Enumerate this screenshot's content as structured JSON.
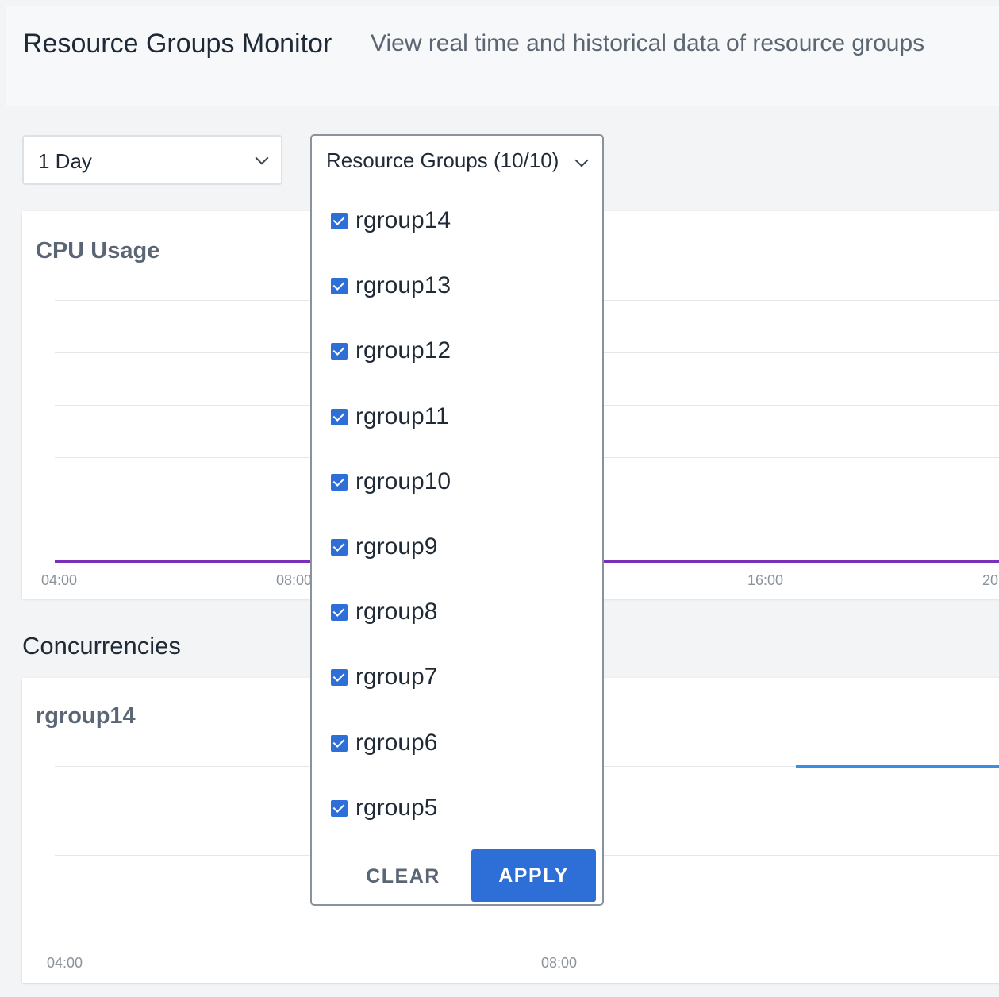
{
  "header": {
    "title": "Resource Groups Monitor",
    "subtitle": "View real time and historical data of resource groups"
  },
  "filters": {
    "time_range": {
      "selected": "1 Day"
    },
    "resource_groups": {
      "label": "Resource Groups (10/10)",
      "options": [
        {
          "label": "rgroup14",
          "checked": true
        },
        {
          "label": "rgroup13",
          "checked": true
        },
        {
          "label": "rgroup12",
          "checked": true
        },
        {
          "label": "rgroup11",
          "checked": true
        },
        {
          "label": "rgroup10",
          "checked": true
        },
        {
          "label": "rgroup9",
          "checked": true
        },
        {
          "label": "rgroup8",
          "checked": true
        },
        {
          "label": "rgroup7",
          "checked": true
        },
        {
          "label": "rgroup6",
          "checked": true
        },
        {
          "label": "rgroup5",
          "checked": true
        }
      ],
      "clear_label": "CLEAR",
      "apply_label": "APPLY"
    }
  },
  "cpu_chart": {
    "title": "CPU Usage",
    "x_ticks": [
      "04:00",
      "08:00",
      "16:00",
      "20"
    ],
    "line_color": "#7a2fb8"
  },
  "concurrencies": {
    "section_title": "Concurrencies",
    "chart_title": "rgroup14",
    "x_ticks": [
      "04:00",
      "08:00"
    ],
    "line_color": "#3c8de0"
  },
  "colors": {
    "accent": "#2d6fd6"
  }
}
